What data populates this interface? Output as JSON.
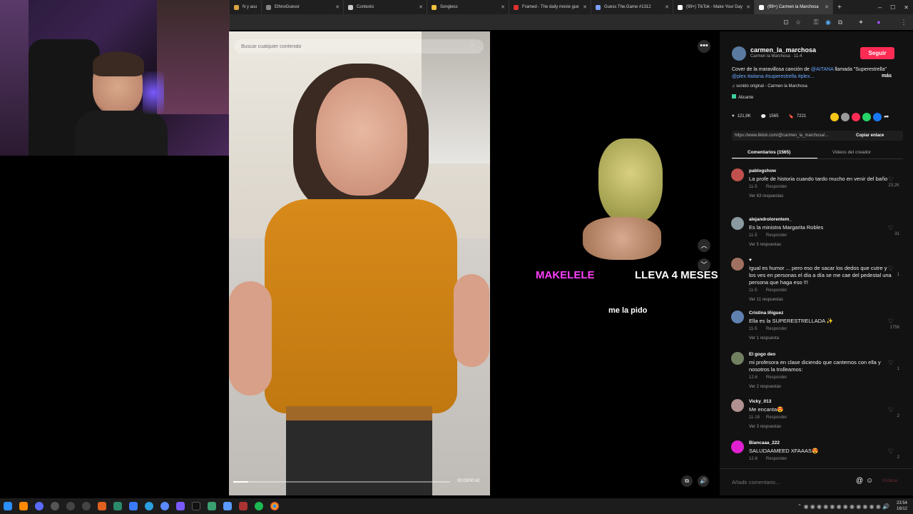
{
  "tabs": [
    {
      "label": "N y acu",
      "color": "#d9a441"
    },
    {
      "label": "EthnoGuessr",
      "color": "#888888"
    },
    {
      "label": "Contexto",
      "color": "#cccccc"
    },
    {
      "label": "Songless",
      "color": "#f0c040"
    },
    {
      "label": "Framed - The daily movie gue",
      "color": "#e03030"
    },
    {
      "label": "Guess The.Game #1312",
      "color": "#7aa0ff"
    },
    {
      "label": "(99+) TikTok - Make Your Day",
      "color": "#ffffff"
    },
    {
      "label": "(99+) Carmen la Marchosa",
      "color": "#ffffff",
      "active": true
    }
  ],
  "video": {
    "search_placeholder": "Buscar cualquier contenido",
    "time": "00:03/00:42",
    "progress": 0.07
  },
  "overlay": {
    "meme_left": "MAKELELE",
    "meme_right": "LLEVA 4 MESES",
    "caption": "me la pido"
  },
  "author": {
    "username": "carmen_la_marchosa",
    "subtitle": "Carmen la Marchosa · 11-4",
    "follow": "Seguir",
    "desc_prefix": "Cover de la maravillosa canción de ",
    "mention": "@AITANA",
    "desc_middle": " llamada \"Superestrella\" ",
    "tags": "@plex #aitana #superestrella #plex...",
    "more": "más",
    "sound": "sonido original - Carmen la Marchosa",
    "location": "Alicante"
  },
  "stats": {
    "likes": "121,9K",
    "comments": "1565",
    "saves": "7221"
  },
  "link": {
    "url": "https://www.tiktok.com/@carmen_la_marchosa/...",
    "copy": "Copiar enlace"
  },
  "tabs_panel": {
    "comments": "Comentarios (1565)",
    "creator": "Videos del creador"
  },
  "comments": [
    {
      "user": "pablogshow",
      "text": "La profe de historia cuando tardo mucho en venir del baño",
      "date": "11-5",
      "reply": "Responder",
      "replies": "Ver 63 respuestas",
      "likes": "23,2K",
      "color": "#c0504d"
    },
    {
      "user": "alejandrolorentem_",
      "text": "Es la ministra Margarita Robles",
      "date": "11-5",
      "reply": "Responder",
      "replies": "Ver 5 respuestas",
      "likes": "31",
      "color": "#8a9aa0"
    },
    {
      "user": "♥",
      "text": "Igual es humor ... pero eso de sacar los dedos que cutre y los ves en personas el día a día se me cae del pedestal una persona que haga eso !!!",
      "date": "11-5",
      "reply": "Responder",
      "replies": "Ver 11 respuestas",
      "likes": "1",
      "color": "#a07060"
    },
    {
      "user": "Cristina Iñiguez",
      "text": "Ella es la SUPERESTRELLADA ✨",
      "date": "11-5",
      "reply": "Responder",
      "replies": "Ver 1 respuesta",
      "likes": "1756",
      "color": "#6080b0"
    },
    {
      "user": "El gogo deo",
      "text": "mi profesora en clase diciendo que cantemos con ella y nosotros la trolleamos:",
      "date": "12-6",
      "reply": "Responder",
      "replies": "Ver 2 respuestas",
      "likes": "1",
      "color": "#708060"
    },
    {
      "user": "Vicky_013",
      "text": "Me encanta😍",
      "date": "11-18",
      "reply": "Responder",
      "replies": "Ver 3 respuestas",
      "likes": "2",
      "color": "#b09090"
    },
    {
      "user": "Biancaaa_222",
      "text": "SALUDAAMEED XFAAAS😍",
      "date": "12-6",
      "reply": "Responder",
      "replies": "",
      "likes": "2",
      "color": "#e020d0"
    }
  ],
  "composer": {
    "placeholder": "Añadir comentario...",
    "publish": "Publicar"
  },
  "taskbar": {
    "time": "23:54",
    "date": "16/12"
  }
}
